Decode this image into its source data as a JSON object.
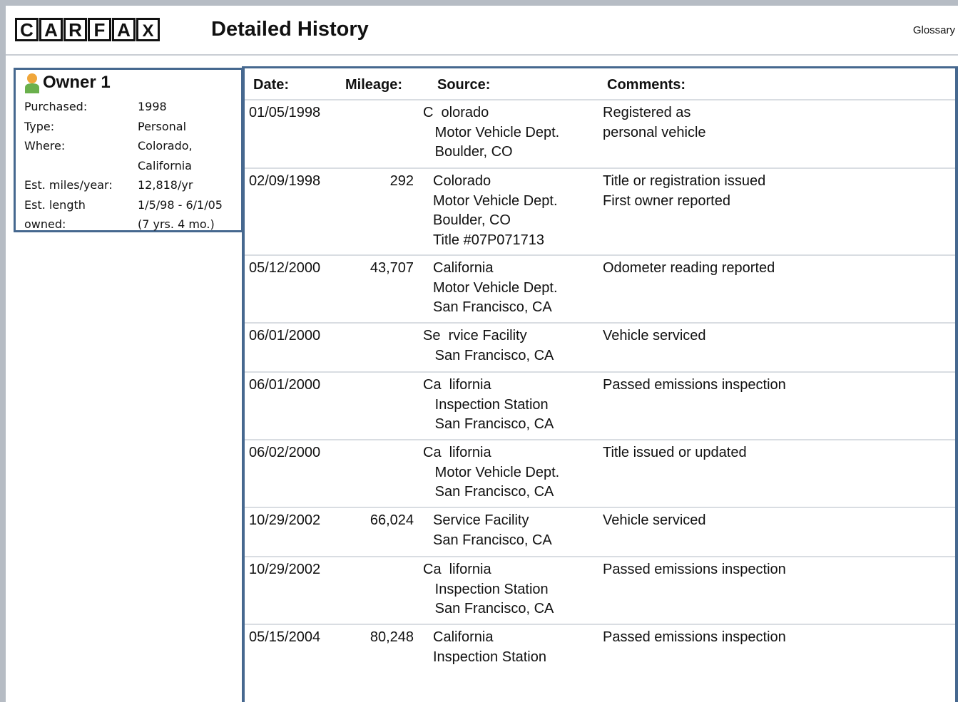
{
  "header": {
    "logo_letters": [
      "C",
      "A",
      "R",
      "F",
      "A",
      "X"
    ],
    "title": "Detailed History",
    "glossary_label": "Glossary"
  },
  "owner": {
    "title": "Owner 1",
    "icon": "person-icon",
    "rows": [
      {
        "key": "Purchased:",
        "value": "1998"
      },
      {
        "key": "Type:",
        "value": "Personal"
      },
      {
        "key": "Where:",
        "value": "Colorado,"
      },
      {
        "key": "",
        "value": "California"
      },
      {
        "key": "Est. miles/year:",
        "value": "12,818/yr"
      },
      {
        "key": "Est. length",
        "value": "1/5/98 - 6/1/05"
      },
      {
        "key": "owned:",
        "value": "(7 yrs. 4 mo.)"
      }
    ]
  },
  "table": {
    "headers": {
      "date": "Date:",
      "mileage": "Mileage:",
      "source": "Source:",
      "comments": "Comments:"
    },
    "rows": [
      {
        "date": "01/05/1998",
        "mileage": "",
        "source": [
          "C  olorado",
          "   Motor Vehicle Dept.",
          "   Boulder, CO"
        ],
        "comments": [
          "Registered as",
          "personal vehicle"
        ]
      },
      {
        "date": "02/09/1998",
        "mileage": "292",
        "source": [
          "Colorado",
          "Motor Vehicle Dept.",
          "Boulder, CO",
          "Title #07P071713"
        ],
        "comments": [
          "Title or registration issued",
          "First owner reported"
        ]
      },
      {
        "date": "05/12/2000",
        "mileage": "43,707",
        "source": [
          "California",
          "Motor Vehicle Dept.",
          "San Francisco, CA"
        ],
        "comments": [
          "Odometer reading reported"
        ]
      },
      {
        "date": "06/01/2000",
        "mileage": "",
        "source": [
          "Se  rvice Facility",
          "   San Francisco, CA"
        ],
        "comments": [
          "Vehicle serviced"
        ]
      },
      {
        "date": "06/01/2000",
        "mileage": "",
        "source": [
          "Ca  lifornia",
          "   Inspection Station",
          "   San Francisco, CA"
        ],
        "comments": [
          "Passed emissions inspection"
        ]
      },
      {
        "date": "06/02/2000",
        "mileage": "",
        "source": [
          "Ca  lifornia",
          "   Motor Vehicle Dept.",
          "   San Francisco, CA"
        ],
        "comments": [
          "Title issued or updated"
        ]
      },
      {
        "date": "10/29/2002",
        "mileage": "66,024",
        "source": [
          "Service Facility",
          "San Francisco, CA"
        ],
        "comments": [
          "Vehicle serviced"
        ]
      },
      {
        "date": "10/29/2002",
        "mileage": "",
        "source": [
          "Ca  lifornia",
          "   Inspection Station",
          "   San Francisco, CA"
        ],
        "comments": [
          "Passed emissions inspection"
        ]
      },
      {
        "date": "05/15/2004",
        "mileage": "80,248",
        "source": [
          "California",
          "Inspection Station"
        ],
        "comments": [
          "Passed emissions inspection"
        ]
      }
    ]
  }
}
